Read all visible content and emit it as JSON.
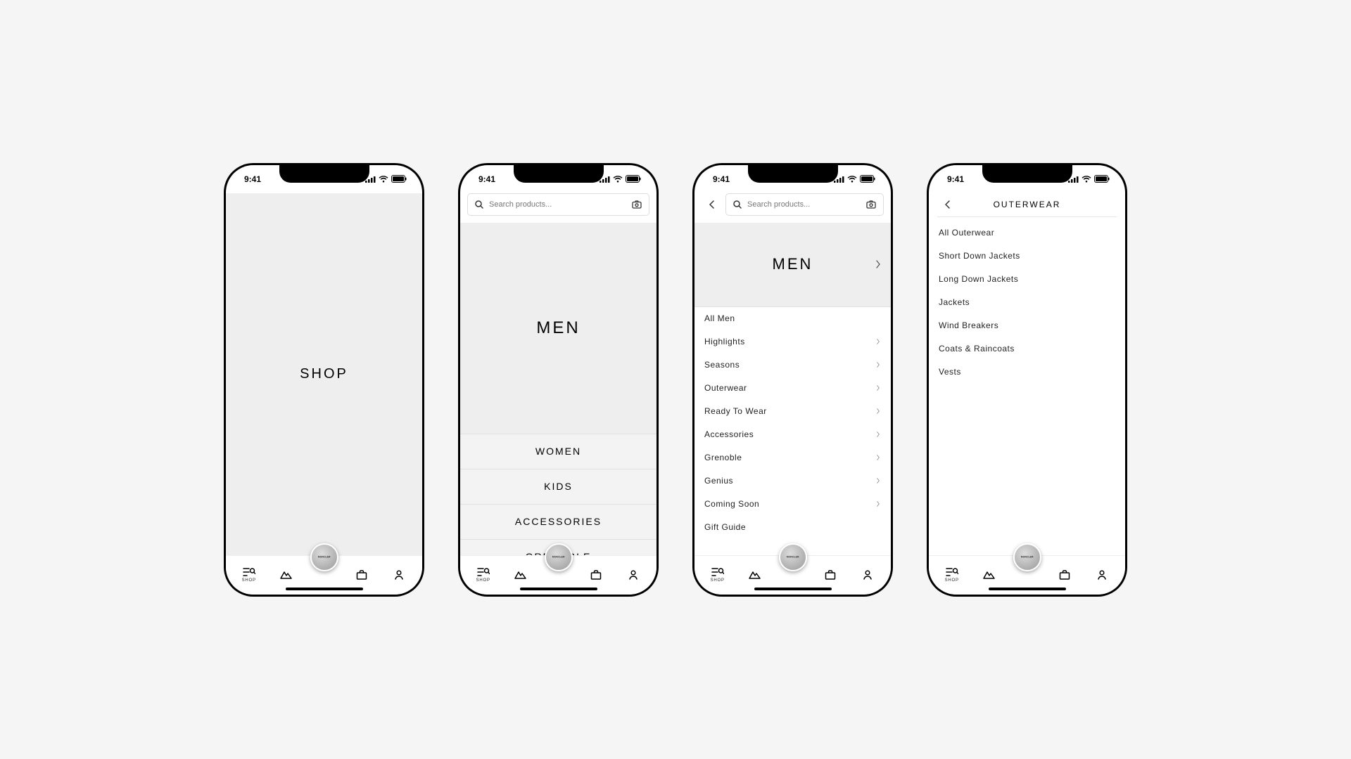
{
  "status": {
    "time": "9:41"
  },
  "search": {
    "placeholder": "Search products..."
  },
  "screens": {
    "shop": {
      "hero": "SHOP"
    },
    "top": {
      "hero": "MEN",
      "cats": [
        "WOMEN",
        "KIDS",
        "ACCESSORIES",
        "GRENOBLE"
      ]
    },
    "men": {
      "hero": "MEN",
      "items": [
        {
          "label": "All Men",
          "chevron": false
        },
        {
          "label": "Highlights",
          "chevron": true
        },
        {
          "label": "Seasons",
          "chevron": true
        },
        {
          "label": "Outerwear",
          "chevron": true
        },
        {
          "label": "Ready To Wear",
          "chevron": true
        },
        {
          "label": "Accessories",
          "chevron": true
        },
        {
          "label": "Grenoble",
          "chevron": true
        },
        {
          "label": "Genius",
          "chevron": true
        },
        {
          "label": "Coming Soon",
          "chevron": true
        },
        {
          "label": "Gift Guide",
          "chevron": false
        }
      ]
    },
    "outerwear": {
      "title": "OUTERWEAR",
      "items": [
        "All Outerwear",
        "Short Down Jackets",
        "Long Down Jackets",
        "Jackets",
        "Wind Breakers",
        "Coats & Raincoats",
        "Vests"
      ]
    }
  },
  "tabs": {
    "shop": "SHOP",
    "logo": "MONCLER"
  }
}
